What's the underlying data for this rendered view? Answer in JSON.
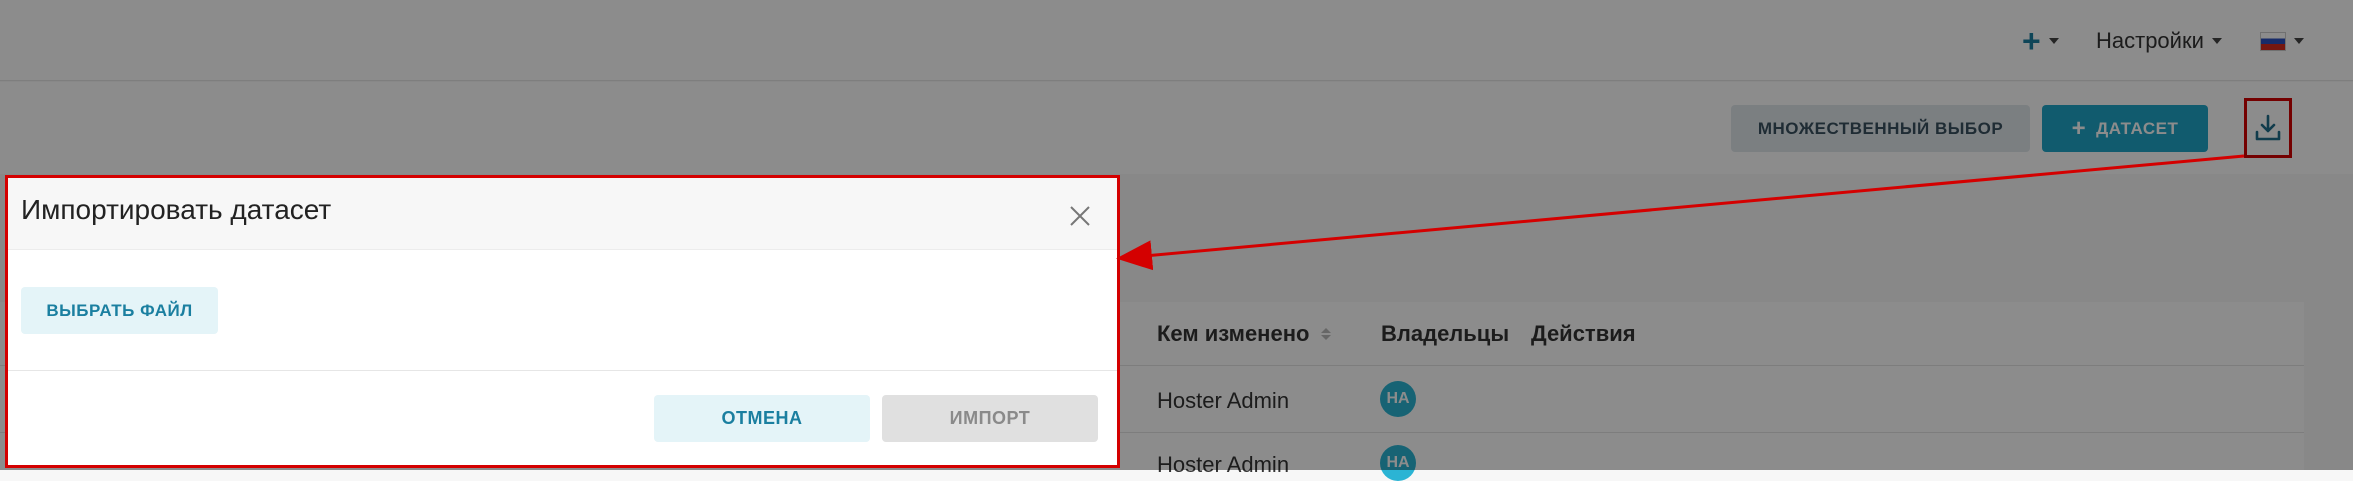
{
  "topbar": {
    "settings_label": "Настройки"
  },
  "toolbar": {
    "multi_select_label": "МНОЖЕСТВЕННЫЙ ВЫБОР",
    "add_dataset_label": "ДАТАСЕТ"
  },
  "table": {
    "columns": [
      "Кем изменено",
      "Владельцы",
      "Действия"
    ],
    "rows": [
      {
        "modified_by": "Hoster Admin",
        "owner_initials": "HA"
      },
      {
        "modified_by": "Hoster Admin",
        "owner_initials": "HA"
      }
    ]
  },
  "modal": {
    "title": "Импортировать датасет",
    "choose_file_label": "ВЫБРАТЬ ФАЙЛ",
    "cancel_label": "ОТМЕНА",
    "import_label": "ИМПОРТ"
  },
  "colors": {
    "accent": "#20a7c9",
    "accent_text": "#1a7fa0",
    "annotation": "#d40000"
  },
  "icons": [
    "plus-icon",
    "chevron-down-icon",
    "russia-flag-icon",
    "download-icon",
    "close-icon",
    "sort-icon"
  ]
}
